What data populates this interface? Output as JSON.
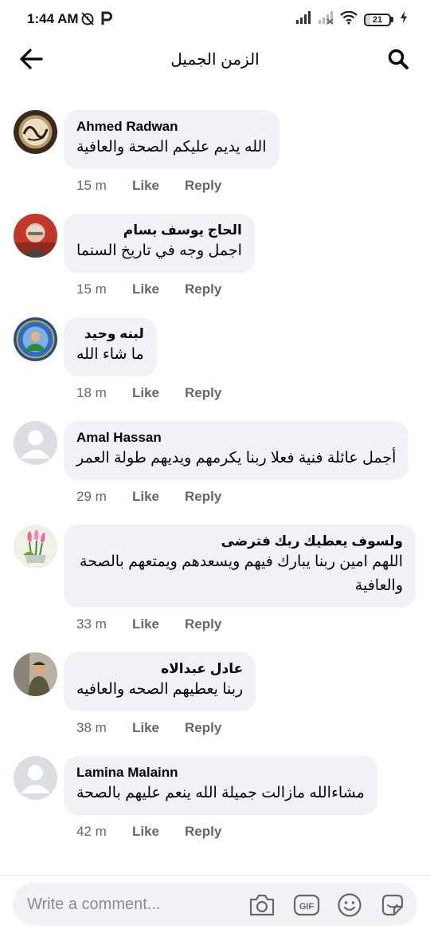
{
  "status_bar": {
    "time": "1:44 AM",
    "notification_icons": [
      "alarm-off-icon",
      "p-icon"
    ],
    "system_icons": [
      "signal-icon",
      "signal-off-icon",
      "wifi-icon",
      "battery-icon",
      "charging-icon"
    ],
    "battery": "21",
    "battery_level_percent": 21
  },
  "header": {
    "title": "الزمن الجميل",
    "back_icon": "arrow-left-icon",
    "search_icon": "search-icon"
  },
  "comments": [
    {
      "author": "Ahmed Radwan",
      "text": "الله يديم عليكم الصحة والعافية",
      "time": "15 m",
      "like": "Like",
      "reply": "Reply"
    },
    {
      "author": "الحاج يوسف بسام",
      "text": "اجمل وجه في تاريخ السنما",
      "time": "15 m",
      "like": "Like",
      "reply": "Reply"
    },
    {
      "author": "لبنه وحيد",
      "text": "ما شاء الله",
      "time": "18 m",
      "like": "Like",
      "reply": "Reply"
    },
    {
      "author": "Amal Hassan",
      "text": "أجمل عائلة فنية فعلا ربنا يكرمهم ويديهم طولة العمر",
      "time": "29 m",
      "like": "Like",
      "reply": "Reply"
    },
    {
      "author": "ولسوف يعطيك ربك فترضى",
      "text": "اللهم امين ربنا يبارك فيهم ويسعدهم ويمتعهم بالصحة والعافية",
      "time": "33 m",
      "like": "Like",
      "reply": "Reply"
    },
    {
      "author": "عادل عبدالاه",
      "text": "ربنا يعطيهم الصحه والعافيه",
      "time": "38 m",
      "like": "Like",
      "reply": "Reply"
    },
    {
      "author": "Lamina Malainn",
      "text": "مشاءالله مازالت جميلة الله ينعم عليهم بالصحة",
      "time": "42 m",
      "like": "Like",
      "reply": "Reply"
    }
  ],
  "composer": {
    "placeholder": "Write a comment...",
    "icons": [
      "camera-icon",
      "gif-icon",
      "emoji-icon",
      "sticker-icon"
    ]
  },
  "colors": {
    "bubble": "#f0f2f5",
    "meta_text": "#65676b",
    "text": "#050505"
  }
}
